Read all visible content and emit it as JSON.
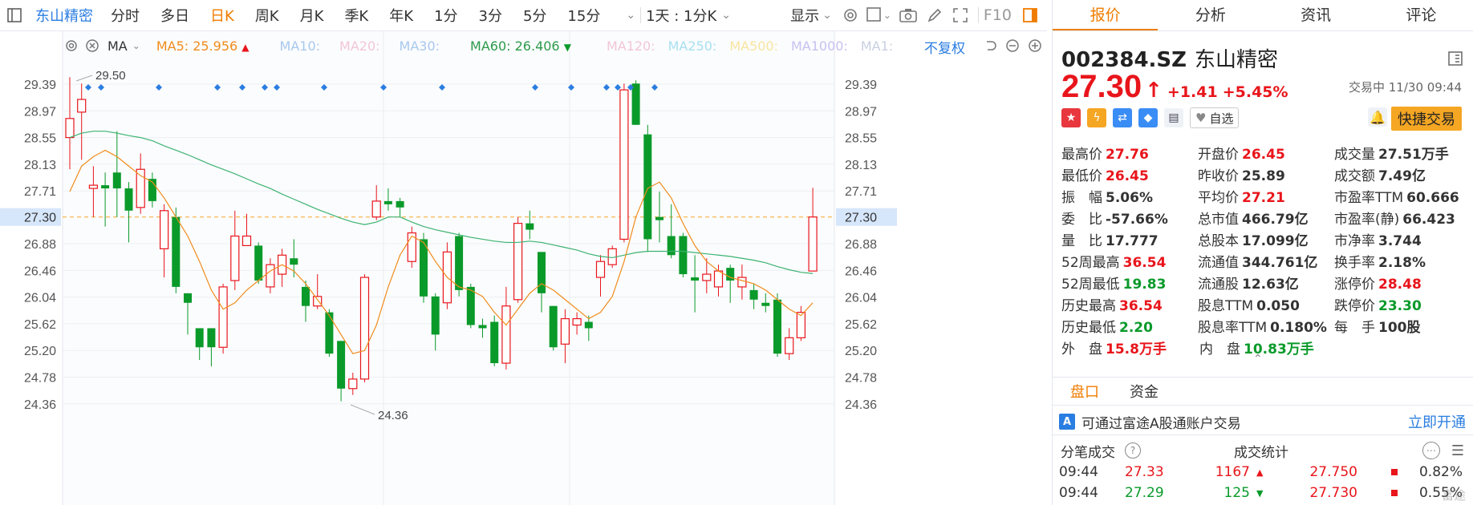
{
  "toolbar": {
    "title": "东山精密",
    "periods": [
      "分时",
      "多日",
      "日K",
      "周K",
      "月K",
      "季K",
      "年K",
      "1分",
      "3分",
      "5分",
      "15分"
    ],
    "active_period": "日K",
    "range_label": "1天 : 1分K",
    "display_label": "显示",
    "f10_label": "F10"
  },
  "ma_bar": {
    "ma_label": "MA",
    "ma5": "MA5: 25.956",
    "ma10": "MA10:",
    "ma20": "MA20:",
    "ma30": "MA30:",
    "ma60": "MA60: 26.406",
    "ma120": "MA120:",
    "ma250": "MA250:",
    "ma500": "MA500:",
    "ma1000": "MA1000:",
    "ma1": "MA1:",
    "adjust": "不复权"
  },
  "colors": {
    "up": "#e8151b",
    "down": "#0a9a2a",
    "ma5": "#f08c1c",
    "ma60": "#3cb371",
    "accent": "#f07c00"
  },
  "chart_data": {
    "type": "candlestick",
    "ylim": [
      24.1,
      29.6
    ],
    "y_ticks": [
      "29.39",
      "28.97",
      "28.55",
      "28.13",
      "27.71",
      "27.30",
      "26.88",
      "26.46",
      "26.04",
      "25.62",
      "25.20",
      "24.78",
      "24.36"
    ],
    "current_price_label": "27.30",
    "high_annotation": "29.50",
    "low_annotation": "24.36",
    "candles": [
      {
        "o": 28.55,
        "c": 28.85,
        "h": 29.5,
        "l": 28.05
      },
      {
        "o": 28.95,
        "c": 29.15,
        "h": 29.4,
        "l": 28.2
      },
      {
        "o": 27.75,
        "c": 27.8,
        "h": 28.1,
        "l": 27.3
      },
      {
        "o": 27.8,
        "c": 27.75,
        "h": 28.0,
        "l": 27.15
      },
      {
        "o": 28.0,
        "c": 27.75,
        "h": 28.65,
        "l": 27.3
      },
      {
        "o": 27.75,
        "c": 27.4,
        "h": 27.85,
        "l": 26.9
      },
      {
        "o": 27.45,
        "c": 28.05,
        "h": 28.3,
        "l": 27.35
      },
      {
        "o": 27.9,
        "c": 27.55,
        "h": 28.0,
        "l": 27.45
      },
      {
        "o": 26.8,
        "c": 27.4,
        "h": 27.5,
        "l": 26.35
      },
      {
        "o": 27.3,
        "c": 26.2,
        "h": 27.45,
        "l": 26.1
      },
      {
        "o": 26.1,
        "c": 25.95,
        "h": 26.1,
        "l": 25.45
      },
      {
        "o": 25.55,
        "c": 25.25,
        "h": 25.55,
        "l": 25.05
      },
      {
        "o": 25.55,
        "c": 25.25,
        "h": 25.55,
        "l": 24.95
      },
      {
        "o": 25.25,
        "c": 26.2,
        "h": 26.25,
        "l": 25.15
      },
      {
        "o": 26.3,
        "c": 27.0,
        "h": 27.4,
        "l": 26.15
      },
      {
        "o": 26.85,
        "c": 27.0,
        "h": 27.35,
        "l": 26.85
      },
      {
        "o": 26.85,
        "c": 26.3,
        "h": 26.9,
        "l": 26.25
      },
      {
        "o": 26.2,
        "c": 26.55,
        "h": 26.65,
        "l": 26.1
      },
      {
        "o": 26.4,
        "c": 26.7,
        "h": 26.8,
        "l": 26.2
      },
      {
        "o": 26.65,
        "c": 26.55,
        "h": 26.95,
        "l": 26.35
      },
      {
        "o": 26.2,
        "c": 25.9,
        "h": 26.3,
        "l": 25.65
      },
      {
        "o": 25.9,
        "c": 26.05,
        "h": 26.4,
        "l": 25.85
      },
      {
        "o": 25.8,
        "c": 25.15,
        "h": 25.85,
        "l": 25.1
      },
      {
        "o": 25.35,
        "c": 24.6,
        "h": 25.35,
        "l": 24.4
      },
      {
        "o": 24.6,
        "c": 24.75,
        "h": 24.85,
        "l": 24.5
      },
      {
        "o": 24.75,
        "c": 26.35,
        "h": 26.4,
        "l": 24.7
      },
      {
        "o": 27.3,
        "c": 27.55,
        "h": 27.8,
        "l": 27.25
      },
      {
        "o": 27.55,
        "c": 27.5,
        "h": 27.75,
        "l": 27.4
      },
      {
        "o": 27.55,
        "c": 27.45,
        "h": 27.6,
        "l": 27.3
      },
      {
        "o": 26.6,
        "c": 27.05,
        "h": 27.15,
        "l": 26.5
      },
      {
        "o": 26.95,
        "c": 26.05,
        "h": 27.05,
        "l": 25.95
      },
      {
        "o": 26.05,
        "c": 25.45,
        "h": 26.1,
        "l": 25.2
      },
      {
        "o": 25.95,
        "c": 26.75,
        "h": 26.9,
        "l": 25.85
      },
      {
        "o": 27.0,
        "c": 26.15,
        "h": 27.05,
        "l": 26.05
      },
      {
        "o": 26.2,
        "c": 25.6,
        "h": 26.25,
        "l": 25.55
      },
      {
        "o": 25.6,
        "c": 25.55,
        "h": 25.7,
        "l": 25.4
      },
      {
        "o": 25.65,
        "c": 25.0,
        "h": 25.75,
        "l": 24.95
      },
      {
        "o": 25.0,
        "c": 25.9,
        "h": 26.2,
        "l": 24.9
      },
      {
        "o": 26.0,
        "c": 27.2,
        "h": 27.3,
        "l": 25.95
      },
      {
        "o": 27.2,
        "c": 27.1,
        "h": 27.4,
        "l": 26.95
      },
      {
        "o": 26.75,
        "c": 26.1,
        "h": 26.75,
        "l": 25.8
      },
      {
        "o": 25.9,
        "c": 25.25,
        "h": 25.9,
        "l": 25.2
      },
      {
        "o": 25.3,
        "c": 25.7,
        "h": 25.85,
        "l": 25.0
      },
      {
        "o": 25.6,
        "c": 25.7,
        "h": 25.8,
        "l": 25.45
      },
      {
        "o": 25.65,
        "c": 25.55,
        "h": 25.75,
        "l": 25.35
      },
      {
        "o": 26.35,
        "c": 26.6,
        "h": 26.7,
        "l": 26.05
      },
      {
        "o": 26.55,
        "c": 26.8,
        "h": 26.85,
        "l": 26.5
      },
      {
        "o": 26.95,
        "c": 29.3,
        "h": 29.4,
        "l": 26.9
      },
      {
        "o": 29.4,
        "c": 28.75,
        "h": 29.45,
        "l": 28.75
      },
      {
        "o": 28.6,
        "c": 26.95,
        "h": 28.75,
        "l": 26.75
      },
      {
        "o": 27.3,
        "c": 27.25,
        "h": 27.7,
        "l": 26.9
      },
      {
        "o": 27.0,
        "c": 26.7,
        "h": 27.5,
        "l": 26.65
      },
      {
        "o": 27.0,
        "c": 26.4,
        "h": 27.05,
        "l": 26.35
      },
      {
        "o": 26.35,
        "c": 26.3,
        "h": 26.7,
        "l": 25.8
      },
      {
        "o": 26.3,
        "c": 26.4,
        "h": 26.65,
        "l": 26.1
      },
      {
        "o": 26.2,
        "c": 26.45,
        "h": 26.55,
        "l": 26.05
      },
      {
        "o": 26.5,
        "c": 26.3,
        "h": 26.55,
        "l": 25.95
      },
      {
        "o": 26.2,
        "c": 26.35,
        "h": 26.55,
        "l": 26.0
      },
      {
        "o": 26.15,
        "c": 26.0,
        "h": 26.25,
        "l": 25.85
      },
      {
        "o": 25.95,
        "c": 25.9,
        "h": 26.1,
        "l": 25.8
      },
      {
        "o": 26.0,
        "c": 25.15,
        "h": 26.1,
        "l": 25.1
      },
      {
        "o": 25.15,
        "c": 25.4,
        "h": 25.55,
        "l": 25.05
      },
      {
        "o": 25.4,
        "c": 25.8,
        "h": 25.9,
        "l": 25.35
      },
      {
        "o": 26.45,
        "c": 27.3,
        "h": 27.76,
        "l": 26.45
      }
    ],
    "ma5": [
      27.7,
      28.1,
      28.25,
      28.35,
      28.25,
      28.1,
      27.95,
      27.85,
      27.6,
      27.3,
      27.0,
      26.6,
      26.15,
      25.85,
      25.95,
      26.15,
      26.3,
      26.45,
      26.55,
      26.45,
      26.25,
      26.0,
      25.75,
      25.45,
      25.15,
      25.2,
      25.6,
      26.2,
      26.7,
      27.0,
      26.9,
      26.6,
      26.35,
      26.2,
      26.15,
      26.05,
      25.8,
      25.6,
      25.85,
      26.1,
      26.25,
      26.15,
      26.0,
      25.85,
      25.7,
      25.8,
      26.05,
      26.6,
      27.3,
      27.75,
      27.85,
      27.6,
      27.2,
      26.85,
      26.6,
      26.45,
      26.35,
      26.3,
      26.25,
      26.15,
      26.0,
      25.85,
      25.75,
      25.95
    ],
    "ma60": [
      28.55,
      28.62,
      28.65,
      28.65,
      28.62,
      28.58,
      28.55,
      28.5,
      28.42,
      28.35,
      28.28,
      28.2,
      28.12,
      28.05,
      27.98,
      27.9,
      27.82,
      27.75,
      27.66,
      27.58,
      27.5,
      27.42,
      27.35,
      27.28,
      27.22,
      27.18,
      27.22,
      27.3,
      27.3,
      27.22,
      27.15,
      27.1,
      27.06,
      27.02,
      26.98,
      26.95,
      26.92,
      26.9,
      26.9,
      26.92,
      26.9,
      26.86,
      26.82,
      26.78,
      26.72,
      26.68,
      26.66,
      26.7,
      26.74,
      26.76,
      26.76,
      26.76,
      26.76,
      26.74,
      26.72,
      26.7,
      26.68,
      26.65,
      26.62,
      26.58,
      26.52,
      26.47,
      26.43,
      26.41
    ]
  },
  "right": {
    "tabs": [
      "报价",
      "分析",
      "资讯",
      "评论"
    ],
    "active_tab": "报价",
    "code": "002384.SZ",
    "name": "东山精密",
    "price": "27.30",
    "change": "+1.41",
    "change_pct": "+5.45%",
    "status": "交易中 11/30 09:44",
    "watchlist_label": "自选",
    "quick_trade": "快捷交易",
    "stats": [
      [
        {
          "l": "最高价",
          "v": "27.76",
          "c": "red"
        },
        {
          "l": "开盘价",
          "v": "26.45",
          "c": "red"
        },
        {
          "l": "成交量",
          "v": "27.51万手",
          "c": "dark"
        }
      ],
      [
        {
          "l": "最低价",
          "v": "26.45",
          "c": "red"
        },
        {
          "l": "昨收价",
          "v": "25.89",
          "c": "dark"
        },
        {
          "l": "成交额",
          "v": "7.49亿",
          "c": "dark"
        }
      ],
      [
        {
          "l": "振　幅",
          "v": "5.06%",
          "c": "dark"
        },
        {
          "l": "平均价",
          "v": "27.21",
          "c": "red"
        },
        {
          "l": "市盈率TTM",
          "v": "60.666",
          "c": "dark"
        }
      ],
      [
        {
          "l": "委　比",
          "v": "-57.66%",
          "c": "dark"
        },
        {
          "l": "总市值",
          "v": "466.79亿",
          "c": "dark"
        },
        {
          "l": "市盈率(静)",
          "v": "66.423",
          "c": "dark"
        }
      ],
      [
        {
          "l": "量　比",
          "v": "17.777",
          "c": "dark"
        },
        {
          "l": "总股本",
          "v": "17.099亿",
          "c": "dark"
        },
        {
          "l": "市净率",
          "v": "3.744",
          "c": "dark"
        }
      ],
      [
        {
          "l": "52周最高",
          "v": "36.54",
          "c": "red"
        },
        {
          "l": "流通值",
          "v": "344.761亿",
          "c": "dark"
        },
        {
          "l": "换手率",
          "v": "2.18%",
          "c": "dark"
        }
      ],
      [
        {
          "l": "52周最低",
          "v": "19.83",
          "c": "green"
        },
        {
          "l": "流通股",
          "v": "12.63亿",
          "c": "dark"
        },
        {
          "l": "涨停价",
          "v": "28.48",
          "c": "red"
        }
      ],
      [
        {
          "l": "历史最高",
          "v": "36.54",
          "c": "red"
        },
        {
          "l": "股息TTM",
          "v": "0.050",
          "c": "dark"
        },
        {
          "l": "跌停价",
          "v": "23.30",
          "c": "green"
        }
      ],
      [
        {
          "l": "历史最低",
          "v": "2.20",
          "c": "green"
        },
        {
          "l": "股息率TTM",
          "v": "0.180%",
          "c": "dark"
        },
        {
          "l": "每　手",
          "v": "100股",
          "c": "dark"
        }
      ],
      [
        {
          "l": "外　盘",
          "v": "15.8万手",
          "c": "red"
        },
        {
          "l": "内　盘",
          "v": "10.83万手",
          "c": "green"
        }
      ]
    ],
    "sub_tabs": [
      "盘口",
      "资金"
    ],
    "hk_text": "可通过富途A股通账户交易",
    "open_now": "立即开通",
    "trades_title": "分笔成交",
    "stats_title": "成交统计",
    "trades": [
      {
        "time": "09:44",
        "price": "27.33",
        "vol": "1167",
        "dir": "up"
      },
      {
        "time": "09:44",
        "price": "27.29",
        "vol": "125",
        "dir": "down"
      }
    ],
    "stat_rows": [
      {
        "price": "27.750",
        "pct": "0.82%"
      },
      {
        "price": "27.730",
        "pct": "0.55%"
      }
    ],
    "watermark": "富途"
  }
}
